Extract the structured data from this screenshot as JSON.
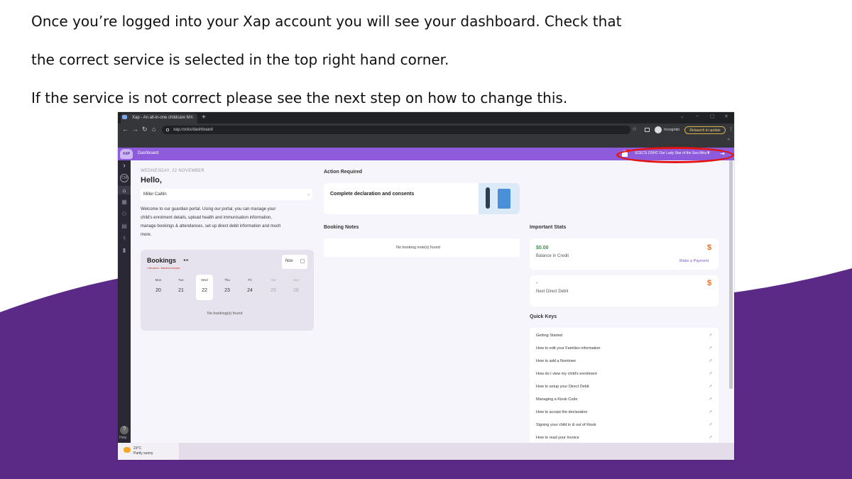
{
  "instructions": [
    "Once you’re logged into your Xap account you will see your dashboard. Check that",
    "the correct service is selected in the top right hand corner.",
    "If the service is not correct please see the next step on how to change this."
  ],
  "browser": {
    "tab_title": "Xap - An all-in-one childcare M…",
    "tab_close": "×",
    "new_tab": "+",
    "url": "xap.rocks/dashboard",
    "incognito_label": "Incognito",
    "relaunch_label": "Relaunch to update",
    "bookmarks_more": "»"
  },
  "app": {
    "logo_text": "XAP",
    "header_title": "Dashboard",
    "service_name": "SCECS OSHC Our Lady Star of the Sea Mira…"
  },
  "sidebar": {
    "avatar_initials": "CM",
    "help_label": "Help"
  },
  "greeting": {
    "date": "WEDNESDAY, 22 NOVEMBER",
    "hello": "Hello,",
    "child": "Miller Caitlin",
    "welcome_lines": [
      "Welcome to our guardian portal. Using our portal, you can manage your",
      "child's enrolment details, upload health and immunisation information,",
      "manage bookings & attendances, set up direct debit information and much",
      "more."
    ]
  },
  "bookings": {
    "title": "Bookings",
    "legend": "• Booked   • Marked Absent",
    "month": "Nov",
    "days": [
      {
        "name": "Mon",
        "date": "20"
      },
      {
        "name": "Tue",
        "date": "21"
      },
      {
        "name": "Wed",
        "date": "22"
      },
      {
        "name": "Thu",
        "date": "23"
      },
      {
        "name": "Fri",
        "date": "24"
      },
      {
        "name": "Sat",
        "date": "25"
      },
      {
        "name": "Sun",
        "date": "26"
      }
    ],
    "empty": "No booking(s) found"
  },
  "action_required": {
    "title": "Action Required",
    "item": "Complete declaration and consents"
  },
  "booking_notes": {
    "title": "Booking Notes",
    "empty": "No booking note(s) found"
  },
  "stats": {
    "title": "Important Stats",
    "credit_value": "$0.00",
    "credit_label": "Balance In Credit",
    "payment_button": "Make a Payment",
    "debit_value": "-",
    "debit_label": "Next Direct Debit",
    "icon_glyph": "$"
  },
  "quick_keys": {
    "title": "Quick Keys",
    "arrow": "↗",
    "items": [
      "Getting Started",
      "How to edit your Families information",
      "How to add a Nominee",
      "How do I view my child's enrolment",
      "How to setup your Direct Debit",
      "Managing a Kiosk Code",
      "How to accept the declaration",
      "Signing your child in & out of Kiosk",
      "How to read your Invoice"
    ]
  },
  "taskbar": {
    "temperature": "23°C",
    "weather": "Partly sunny"
  },
  "colors": {
    "brand_purple": "#8e5bdc",
    "highlight_red": "#e31414",
    "credit_green": "#2e9b3e",
    "slide_purple": "#5b2a86"
  }
}
